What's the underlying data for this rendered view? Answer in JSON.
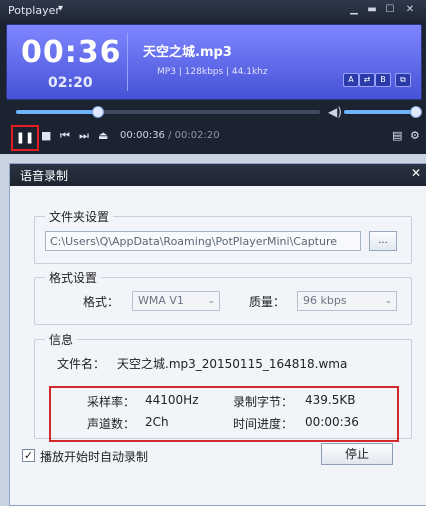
{
  "player": {
    "app_name": "Potplayer",
    "current_time": "00:36",
    "total_time_small": "02:20",
    "track_title": "天空之城.mp3",
    "track_info": "MP3  |  128kbps  |  44.1khz",
    "screen_buttons": [
      "A",
      "⇄",
      "B",
      "⧉",
      "↻"
    ],
    "seek_progress": 0.27,
    "volume_level": 1.0,
    "readout_current": "00:00:36",
    "readout_sep": " / ",
    "readout_total": "00:02:20",
    "accent_color": "#6fb3ff",
    "highlight_color": "#e02020"
  },
  "dialog": {
    "title": "语音录制",
    "folder_group_label": "文件夹设置",
    "folder_path": "C:\\Users\\Q\\AppData\\Roaming\\PotPlayerMini\\Capture",
    "browse_label": "...",
    "format_group_label": "格式设置",
    "format_label": "格式：",
    "format_value": "WMA V1",
    "quality_label": "质量：",
    "quality_value": "96 kbps",
    "info_group_label": "信息",
    "filename_label": "文件名：",
    "filename_value": "天空之城.mp3_20150115_164818.wma",
    "sample_rate_label": "采样率：",
    "sample_rate_value": "44100Hz",
    "bytes_label": "录制字节：",
    "bytes_value": "439.5KB",
    "channels_label": "声道数：",
    "channels_value": "2Ch",
    "progress_label": "时间进度：",
    "progress_value": "00:00:36",
    "autostart_label": "播放开始时自动录制",
    "autostart_checked": true,
    "stop_label": "停止"
  }
}
